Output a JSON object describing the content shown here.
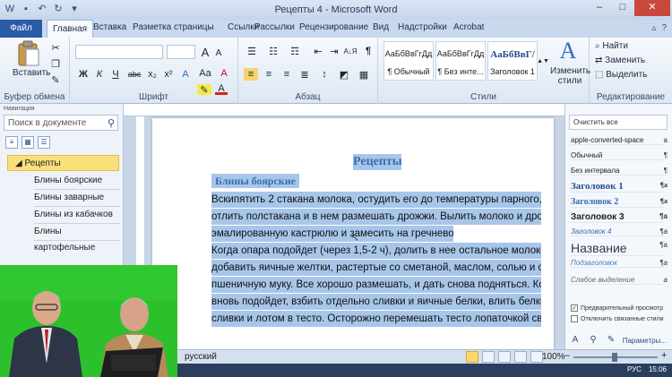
{
  "window": {
    "title": "Рецепты 4 - Microsoft Word",
    "controls": [
      "–",
      "□",
      "✕"
    ]
  },
  "tabs": {
    "file": "Файл",
    "items": [
      "Главная",
      "Вставка",
      "Разметка страницы",
      "Ссылки",
      "Рассылки",
      "Рецензирование",
      "Вид",
      "Надстройки",
      "Acrobat"
    ],
    "active": "Главная",
    "right_glyphs": [
      "▵",
      "?"
    ]
  },
  "ribbon": {
    "clipboard": {
      "paste": "Вставить",
      "label": "Буфер обмена"
    },
    "font": {
      "name_value": "",
      "size_value": "",
      "grow": "A",
      "shrink": "A",
      "case": "Aa",
      "clear": "A",
      "bold": "Ж",
      "italic": "К",
      "underline": "Ч",
      "strike": "abc",
      "sub": "x₂",
      "sup": "x²",
      "label": "Шрифт"
    },
    "paragraph": {
      "label": "Абзац",
      "pilcrow": "¶",
      "sort": "А↓Я"
    },
    "styles": {
      "items": [
        {
          "sample": "АаБбВвГгДд",
          "name": "¶ Обычный"
        },
        {
          "sample": "АаБбВвГгДд",
          "name": "¶ Без инте..."
        },
        {
          "sample": "АаБбВвГ/",
          "name": "Заголовок 1"
        }
      ],
      "change": "Изменить стили",
      "label": "Стили"
    },
    "editing": {
      "find": "Найти",
      "replace": "Заменить",
      "select": "Выделить",
      "label": "Редактирование"
    }
  },
  "nav": {
    "header": "Навигация",
    "search_placeholder": "Поиск в документе",
    "root": "Рецепты",
    "children": [
      "Блины боярские",
      "Блины заварные",
      "Блины из кабачков",
      "Блины картофельные"
    ]
  },
  "document": {
    "title": "Рецепты",
    "heading": "Блины боярские",
    "lines": [
      "        Вскипятить 2 стакана молока, остудить его до температуры парного,",
      "отлить полстакана и в нем размешать дрожжи. Вылить молоко и дрожжи в",
      "эмалированную кастрюлю и замесить на гречневой муке опару.",
      "        Когда опара подойдет (через 1,5-2 ч), долить в нее остальное молоко,",
      "добавить яичные желтки, растертые со сметаной, маслом, солью и сахаром,",
      "пшеничную муку. Все хорошо размешать, и дать снова подняться. Когда тесто",
      "вновь подойдет, взбить отдельно сливки и яичные белки, влить белки в",
      "сливки и лотом в тесто. Осторожно перемешать тесто лопаточкой сверху"
    ]
  },
  "styles_pane": {
    "clear": "Очистить все",
    "items": [
      {
        "name": "apple-converted-space",
        "mark": "a"
      },
      {
        "name": "Обычный",
        "mark": "¶"
      },
      {
        "name": "Без интервала",
        "mark": "¶"
      },
      {
        "name": "Заголовок 1",
        "mark": "¶a"
      },
      {
        "name": "Заголовок 2",
        "mark": "¶a"
      },
      {
        "name": "Заголовок 3",
        "mark": "¶a"
      },
      {
        "name": "Заголовок 4",
        "mark": "¶a"
      },
      {
        "name": "Название",
        "mark": "¶a"
      },
      {
        "name": "Подзаголовок",
        "mark": "¶a"
      },
      {
        "name": "Слабое выделение",
        "mark": "a"
      }
    ],
    "preview": "Предварительный просмотр",
    "disable_linked": "Отключить связанные стили",
    "params": "Параметры..."
  },
  "status": {
    "language": "русский",
    "zoom": "100%",
    "zoom_level": 100,
    "minus": "–",
    "plus": "+"
  },
  "taskbar": {
    "lang": "РУС",
    "time": "15:06"
  },
  "colors": {
    "selection": "#a7c6ea",
    "heading": "#3b6db0",
    "file_tab": "#2a5ba8",
    "nav_selected": "#f9e07a",
    "video_bg": "#2cc12c"
  }
}
